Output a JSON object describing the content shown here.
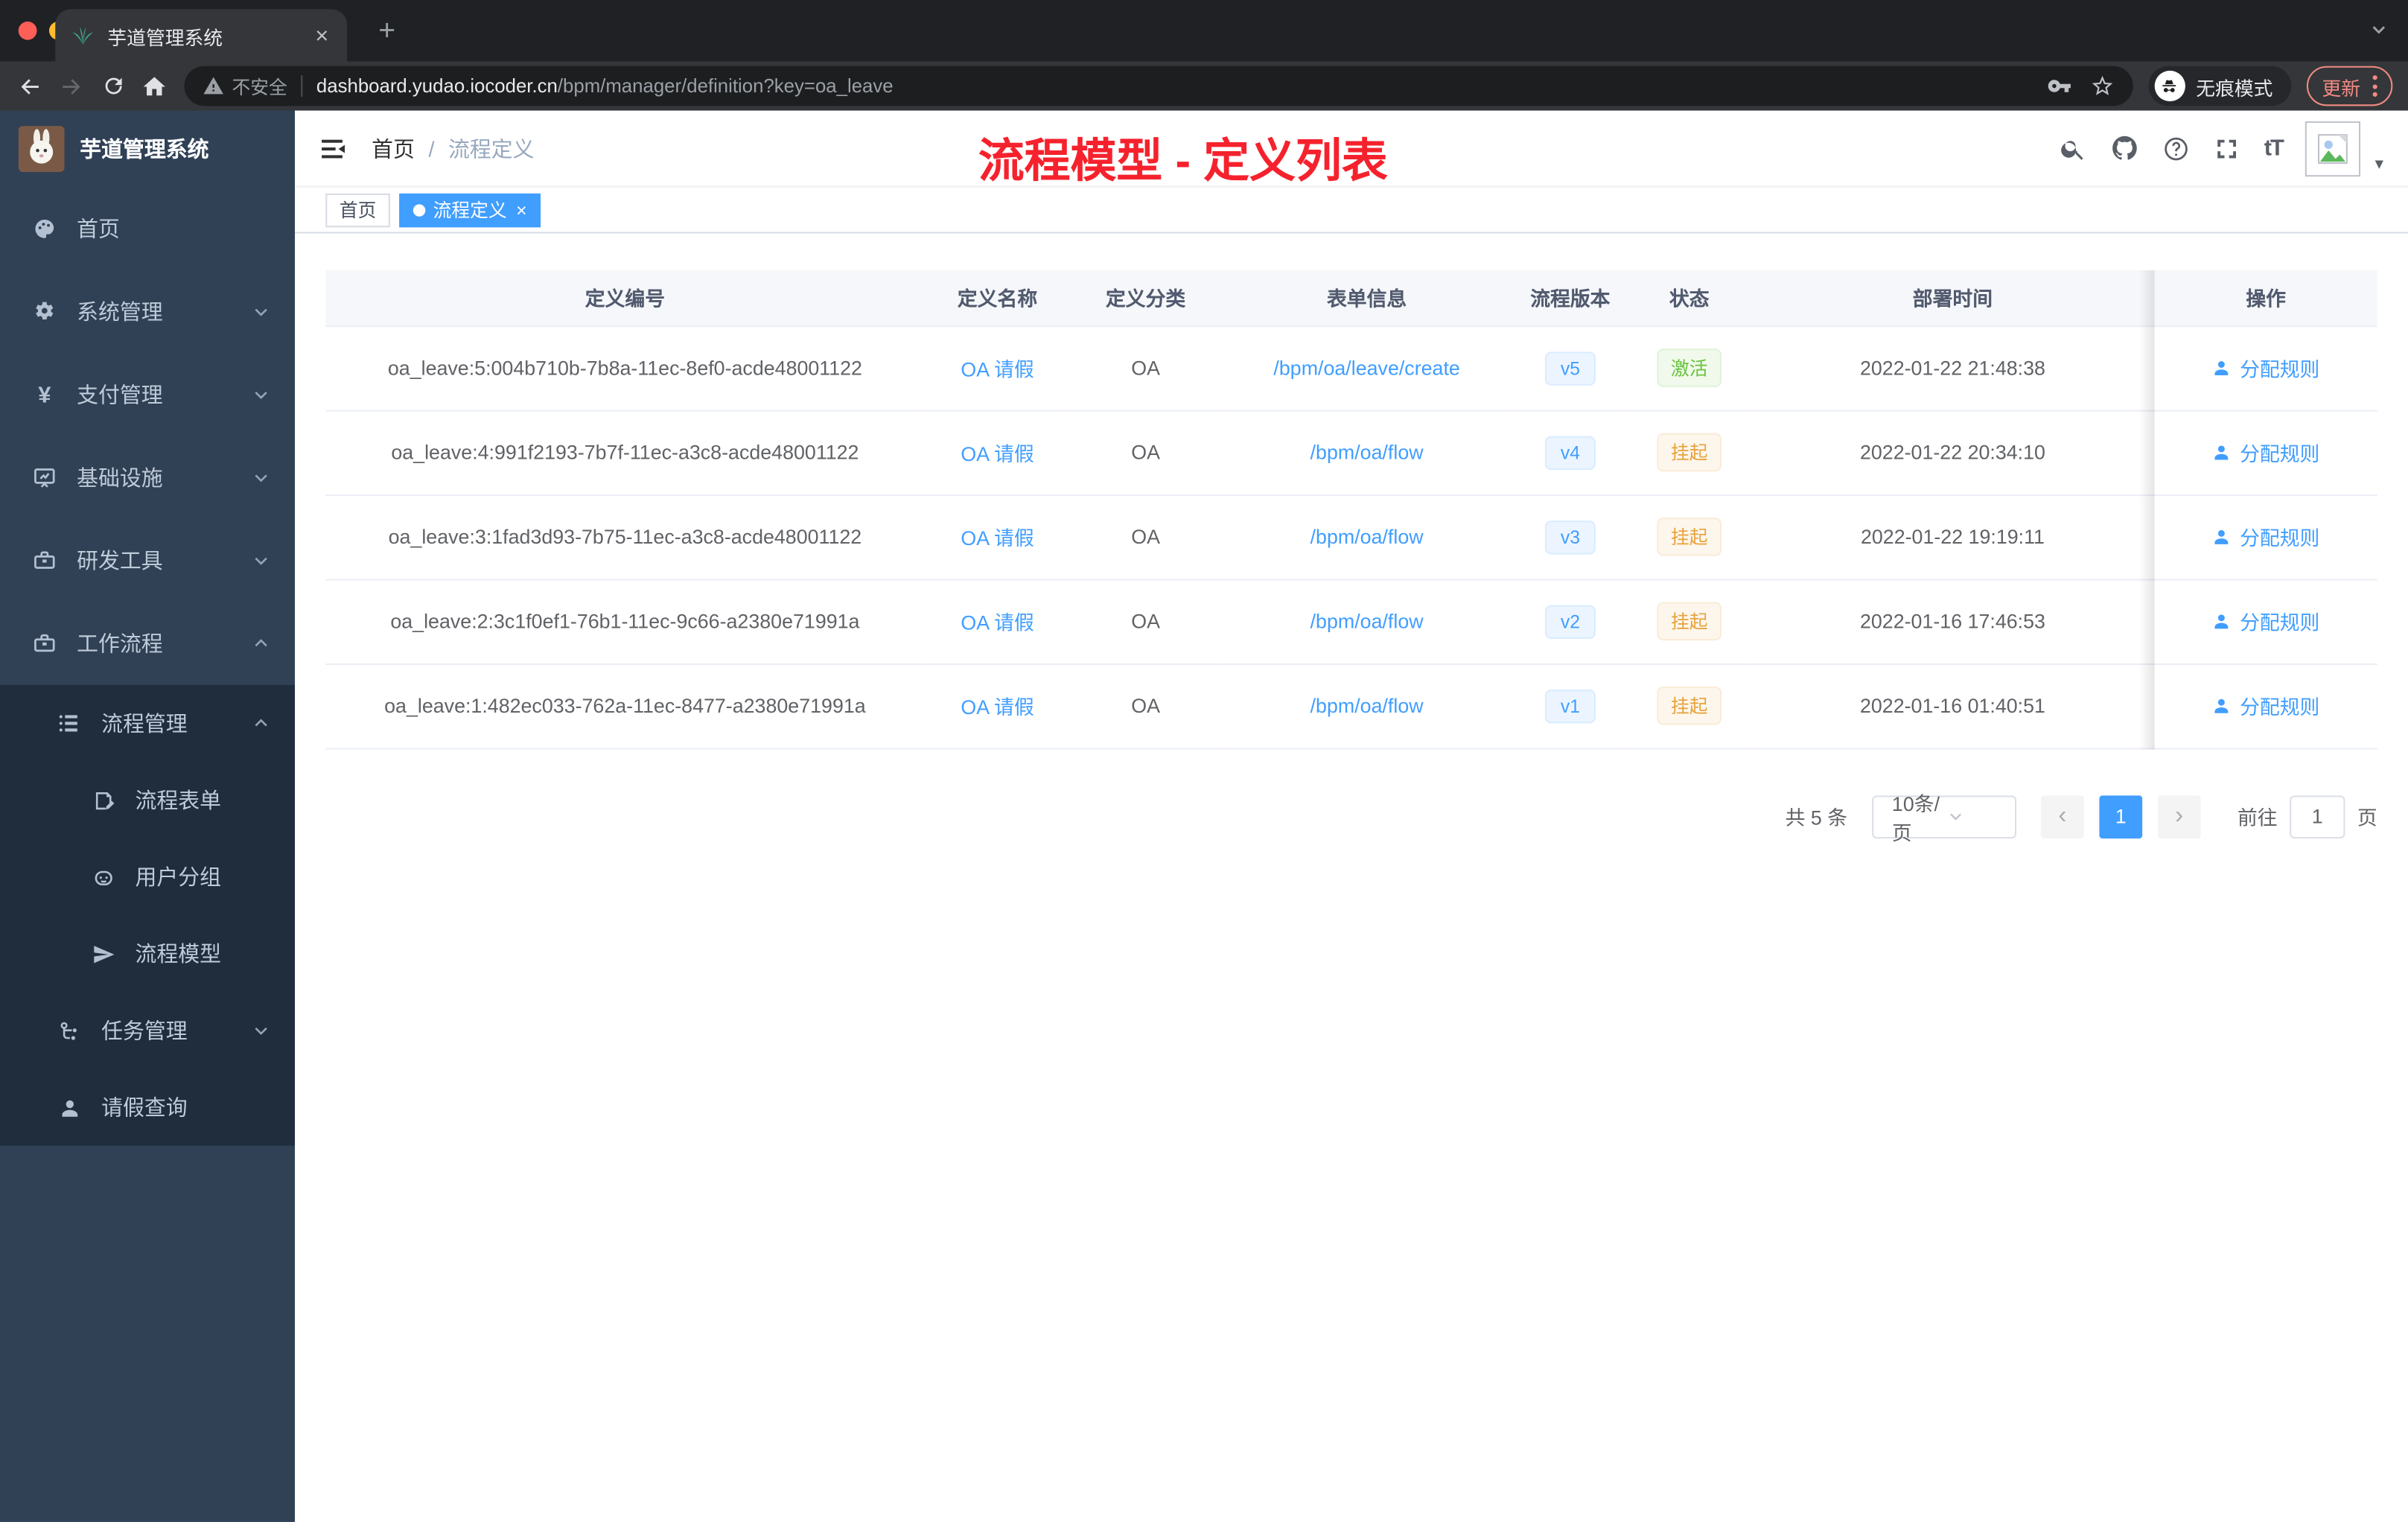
{
  "browser": {
    "tab_title": "芋道管理系统",
    "security_label": "不安全",
    "url_host": "dashboard.yudao.iocoder.cn",
    "url_path": "/bpm/manager/definition?key=oa_leave",
    "incognito_label": "无痕模式",
    "update_label": "更新"
  },
  "icons": {
    "close": "×",
    "plus": "+",
    "chevron_left": "‹",
    "chevron_right": "›",
    "caret_down": "▾",
    "font_size": "tT",
    "yen": "¥"
  },
  "sidebar": {
    "logo_title": "芋道管理系统",
    "menu": [
      {
        "label": "首页"
      },
      {
        "label": "系统管理"
      },
      {
        "label": "支付管理"
      },
      {
        "label": "基础设施"
      },
      {
        "label": "研发工具"
      },
      {
        "label": "工作流程"
      }
    ],
    "workflow_submenu": {
      "process_mgmt": {
        "label": "流程管理"
      },
      "children": [
        {
          "label": "流程表单"
        },
        {
          "label": "用户分组"
        },
        {
          "label": "流程模型"
        }
      ],
      "task_mgmt": {
        "label": "任务管理"
      },
      "leave_query": {
        "label": "请假查询"
      }
    }
  },
  "header": {
    "breadcrumb": [
      "首页",
      "流程定义"
    ],
    "annotation": "流程模型 - 定义列表"
  },
  "tags": {
    "home": "首页",
    "active": "流程定义"
  },
  "table": {
    "columns": [
      "定义编号",
      "定义名称",
      "定义分类",
      "表单信息",
      "流程版本",
      "状态",
      "部署时间",
      "操作"
    ],
    "rows": [
      {
        "id": "oa_leave:5:004b710b-7b8a-11ec-8ef0-acde48001122",
        "name": "OA 请假",
        "category": "OA",
        "form": "/bpm/oa/leave/create",
        "version": "v5",
        "status": "激活",
        "status_type": "active",
        "deployed_at": "2022-01-22 21:48:38",
        "action": "分配规则"
      },
      {
        "id": "oa_leave:4:991f2193-7b7f-11ec-a3c8-acde48001122",
        "name": "OA 请假",
        "category": "OA",
        "form": "/bpm/oa/flow",
        "version": "v4",
        "status": "挂起",
        "status_type": "suspended",
        "deployed_at": "2022-01-22 20:34:10",
        "action": "分配规则"
      },
      {
        "id": "oa_leave:3:1fad3d93-7b75-11ec-a3c8-acde48001122",
        "name": "OA 请假",
        "category": "OA",
        "form": "/bpm/oa/flow",
        "version": "v3",
        "status": "挂起",
        "status_type": "suspended",
        "deployed_at": "2022-01-22 19:19:11",
        "action": "分配规则"
      },
      {
        "id": "oa_leave:2:3c1f0ef1-76b1-11ec-9c66-a2380e71991a",
        "name": "OA 请假",
        "category": "OA",
        "form": "/bpm/oa/flow",
        "version": "v2",
        "status": "挂起",
        "status_type": "suspended",
        "deployed_at": "2022-01-16 17:46:53",
        "action": "分配规则"
      },
      {
        "id": "oa_leave:1:482ec033-762a-11ec-8477-a2380e71991a",
        "name": "OA 请假",
        "category": "OA",
        "form": "/bpm/oa/flow",
        "version": "v1",
        "status": "挂起",
        "status_type": "suspended",
        "deployed_at": "2022-01-16 01:40:51",
        "action": "分配规则"
      }
    ]
  },
  "pagination": {
    "total": "共 5 条",
    "page_size": "10条/页",
    "page": "1",
    "goto_prefix": "前往",
    "goto_value": "1",
    "goto_suffix": "页"
  },
  "colors": {
    "accent": "#409EFF",
    "sidebar_bg": "#304156",
    "submenu_bg": "#1F2D3D",
    "status_active": "#67C23A",
    "status_suspended": "#E6A23C",
    "annotation_red": "#F5222D"
  }
}
